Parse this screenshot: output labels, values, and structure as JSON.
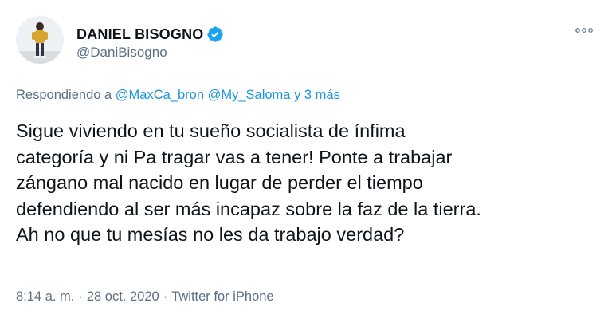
{
  "author": {
    "display_name": "DANIEL BISOGNO",
    "handle": "@DaniBisogno",
    "verified": true,
    "verified_icon": "verified-badge-icon"
  },
  "more_icon": "more-options-icon",
  "reply": {
    "prefix": "Respondiendo a",
    "mention_1": "@MaxCa_bron",
    "mention_2": "@My_Saloma",
    "suffix": "y 3 más"
  },
  "tweet": {
    "lines": [
      "Sigue viviendo en tu sueño socialista de ínfima",
      "categoría y ni Pa tragar vas a tener! Ponte a trabajar",
      "zángano mal nacido en lugar de perder el tiempo",
      "defendiendo al ser más incapaz sobre la faz de la tierra.",
      "Ah no que tu mesías no les da trabajo verdad?"
    ]
  },
  "meta": {
    "time": "8:14 a. m.",
    "date": "28 oct. 2020",
    "source": "Twitter for iPhone",
    "separator": "·"
  },
  "colors": {
    "text": "#0f1419",
    "secondary": "#5b7083",
    "link": "#1b95e0",
    "verified": "#1da1f2"
  }
}
